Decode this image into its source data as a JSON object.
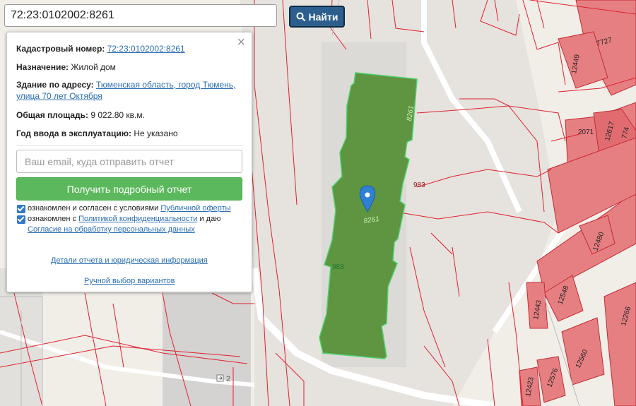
{
  "search": {
    "query": "72:23:0102002:8261",
    "button_label": "Найти"
  },
  "popup": {
    "cadastral_label": "Кадастровый номер:",
    "cadastral_value": "72:23:0102002:8261",
    "purpose_label": "Назначение:",
    "purpose_value": "Жилой дом",
    "address_label": "Здание по адресу:",
    "address_line1": "Тюменская область, город Тюмень,",
    "address_line2": "улица 70 лет Октября",
    "area_label": "Общая площадь:",
    "area_value": "9 022.80 кв.м.",
    "year_label": "Год ввода в эксплуатацию:",
    "year_value": "Не указано",
    "email_placeholder": "Ваш email, куда отправить отчет",
    "report_button": "Получить подробный отчет",
    "agree1_text": "ознакомлен и согласен с условиями",
    "agree1_link": "Публичной оферты",
    "agree2_text_a": "ознакомлен с",
    "agree2_link_a": "Политикой конфиденциальности",
    "agree2_text_b": "и даю",
    "agree2_link_b": "Согласие на обработку персональных данных",
    "details_link": "Детали отчета и юридическая информация",
    "manual_link": "Ручной выбор вариантов",
    "close_symbol": "×"
  },
  "map": {
    "parcel_color": "#5f9441",
    "building_color": "#e67f82",
    "boundary_color": "#e0202e",
    "labels": {
      "l8261a": "8261",
      "l8261b": "8261",
      "l983a": "983",
      "l983b": "983",
      "l7727": "7727",
      "l12449": "12449",
      "l2071": "2071",
      "l12617": "12617",
      "l774": "774",
      "l12480": "12480",
      "l12548": "12548",
      "l12443": "12443",
      "l12266": "12266",
      "l12560": "12560",
      "l12576": "12576",
      "l12423": "12423",
      "l2": "2"
    }
  }
}
